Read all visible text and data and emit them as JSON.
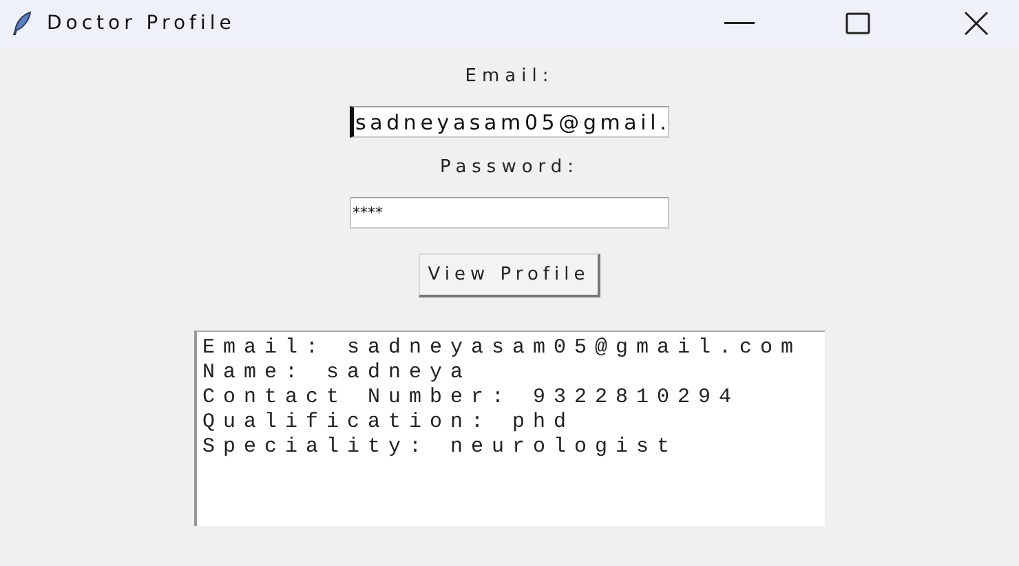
{
  "window": {
    "title": "Doctor Profile"
  },
  "form": {
    "email_label": "Email:",
    "email_value": "sadneyasam05@gmail.",
    "password_label": "Password:",
    "password_value": "****",
    "button": "View Profile"
  },
  "output": {
    "lines": [
      "Email: sadneyasam05@gmail.com",
      "Name: sadneya",
      "Contact Number: 9322810294",
      "Qualification: phd",
      "Speciality: neurologist"
    ]
  }
}
